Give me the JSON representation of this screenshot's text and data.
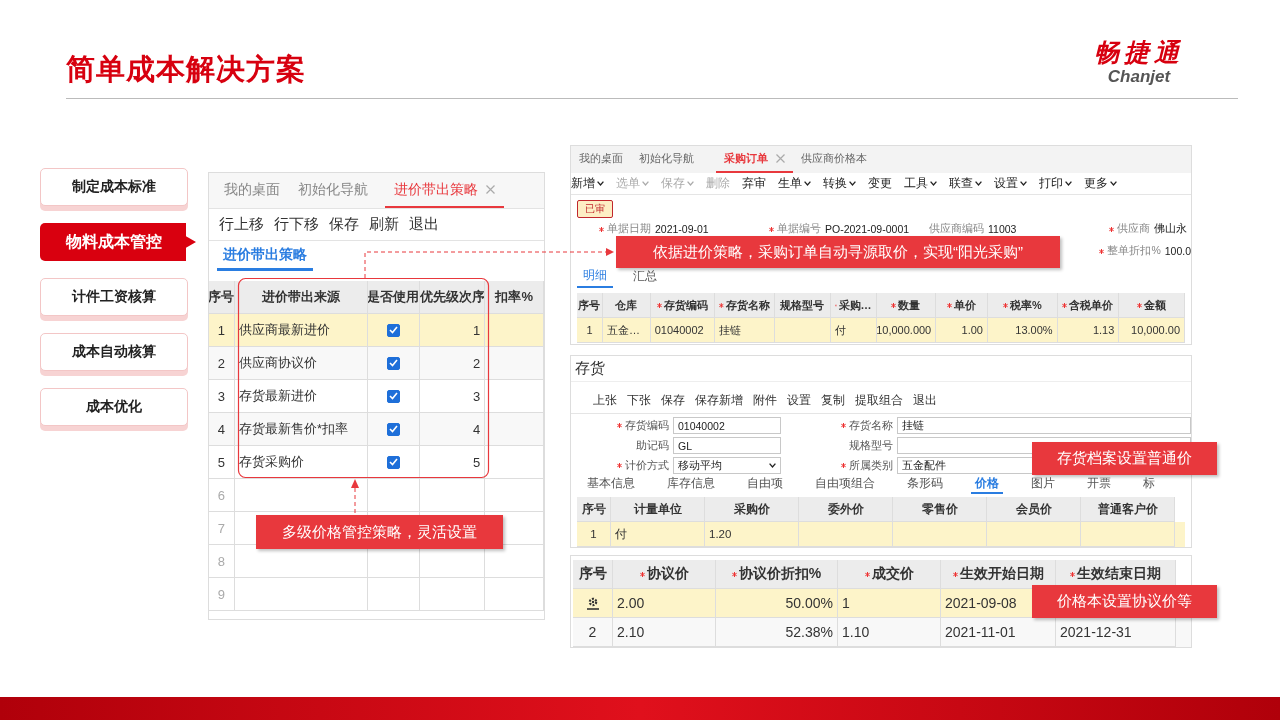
{
  "title": "简单成本解决方案",
  "logo": {
    "name": "畅捷通",
    "latin": "Chanjet"
  },
  "nav": [
    {
      "label": "制定成本标准",
      "selected": false
    },
    {
      "label": "物料成本管控",
      "selected": true
    },
    {
      "label": "计件工资核算",
      "selected": false
    },
    {
      "label": "成本自动核算",
      "selected": false
    },
    {
      "label": "成本优化",
      "selected": false
    }
  ],
  "strategy_window": {
    "tabs": [
      {
        "label": "我的桌面",
        "selected": false,
        "closable": false
      },
      {
        "label": "初始化导航",
        "selected": false,
        "closable": false
      },
      {
        "label": "进价带出策略",
        "selected": true,
        "closable": true
      }
    ],
    "toolbar": [
      "行上移",
      "行下移",
      "保存",
      "刷新",
      "退出"
    ],
    "subtabs": [
      {
        "label": "进价带出策略",
        "selected": true
      }
    ],
    "columns": [
      "序号",
      "进价带出来源",
      "是否使用",
      "优先级次序",
      "扣率%"
    ],
    "rows": [
      {
        "index": "1",
        "source": "供应商最新进价",
        "used": true,
        "priority": "1",
        "selected": true
      },
      {
        "index": "2",
        "source": "供应商协议价",
        "used": true,
        "priority": "2",
        "selected": false
      },
      {
        "index": "3",
        "source": "存货最新进价",
        "used": true,
        "priority": "3",
        "selected": false
      },
      {
        "index": "4",
        "source": "存货最新售价*扣率",
        "used": true,
        "priority": "4",
        "selected": false
      },
      {
        "index": "5",
        "source": "存货采购价",
        "used": true,
        "priority": "5",
        "selected": false
      }
    ],
    "empty_rows": [
      "6",
      "7",
      "8",
      "9"
    ]
  },
  "order_window": {
    "tabs": [
      {
        "label": "我的桌面",
        "selected": false,
        "closable": false
      },
      {
        "label": "初始化导航",
        "selected": false,
        "closable": false
      },
      {
        "label": "采购订单",
        "selected": true,
        "closable": true
      },
      {
        "label": "供应商价格本",
        "selected": false,
        "closable": false
      }
    ],
    "toolbar": [
      {
        "label": "新增",
        "menu": true,
        "disabled": false
      },
      {
        "label": "选单",
        "menu": true,
        "disabled": true
      },
      {
        "label": "保存",
        "menu": true,
        "disabled": true
      },
      {
        "label": "删除",
        "menu": false,
        "disabled": true
      },
      {
        "label": "弃审",
        "menu": false,
        "disabled": false
      },
      {
        "label": "生单",
        "menu": true,
        "disabled": false
      },
      {
        "label": "转换",
        "menu": true,
        "disabled": false
      },
      {
        "label": "变更",
        "menu": false,
        "disabled": false
      },
      {
        "label": "工具",
        "menu": true,
        "disabled": false
      },
      {
        "label": "联查",
        "menu": true,
        "disabled": false
      },
      {
        "label": "设置",
        "menu": true,
        "disabled": false
      },
      {
        "label": "打印",
        "menu": true,
        "disabled": false
      },
      {
        "label": "更多",
        "menu": true,
        "disabled": false
      }
    ],
    "status": "已审",
    "fields": [
      {
        "label": "单据日期",
        "value": "2021-09-01",
        "required": true
      },
      {
        "label": "单据编号",
        "value": "PO-2021-09-0001",
        "required": true
      },
      {
        "label": "供应商编码",
        "value": "11003",
        "required": false
      },
      {
        "label": "供应商",
        "value": "佛山永",
        "required": true
      }
    ],
    "fields_row_2": [
      {
        "label": "整单折扣%",
        "value": "100.0",
        "required": true
      }
    ],
    "subtabs": [
      {
        "label": "明细",
        "selected": true
      },
      {
        "label": "汇总",
        "selected": false
      }
    ],
    "columns": [
      {
        "label": "序号",
        "required": false
      },
      {
        "label": "仓库",
        "required": false
      },
      {
        "label": "存货编码",
        "required": true
      },
      {
        "label": "存货名称",
        "required": true
      },
      {
        "label": "规格型号",
        "required": false
      },
      {
        "label": "采购…",
        "required": true
      },
      {
        "label": "数量",
        "required": true
      },
      {
        "label": "单价",
        "required": true
      },
      {
        "label": "税率%",
        "required": true
      },
      {
        "label": "含税单价",
        "required": true
      },
      {
        "label": "金额",
        "required": true
      }
    ],
    "rows": [
      {
        "selected": true,
        "cells": [
          "1",
          "五金…",
          "01040002",
          "挂链",
          null,
          "付",
          "10,000.000",
          "1.00",
          "13.00%",
          "1.13",
          "10,000.00"
        ]
      }
    ]
  },
  "item_window": {
    "title": "存货",
    "toolbar": [
      "上张",
      "下张",
      "保存",
      "保存新增",
      "附件",
      "设置",
      "复制",
      "提取组合",
      "退出"
    ],
    "fields": [
      {
        "label": "存货编码",
        "value": "01040002",
        "required": true,
        "kind": "text"
      },
      {
        "label": "存货名称",
        "value": "挂链",
        "required": true,
        "kind": "text"
      },
      {
        "label": "助记码",
        "value": "GL",
        "required": false,
        "kind": "text"
      },
      {
        "label": "规格型号",
        "required": false,
        "kind": "text"
      },
      {
        "label": "计价方式",
        "value": "移动平均",
        "required": true,
        "kind": "select"
      },
      {
        "label": "所属类别",
        "value": "五金配件",
        "required": true,
        "kind": "text"
      }
    ],
    "tabs": [
      {
        "label": "基本信息",
        "selected": false
      },
      {
        "label": "库存信息",
        "selected": false
      },
      {
        "label": "自由项",
        "selected": false
      },
      {
        "label": "自由项组合",
        "selected": false
      },
      {
        "label": "条形码",
        "selected": false
      },
      {
        "label": "价格",
        "selected": true
      },
      {
        "label": "图片",
        "selected": false
      },
      {
        "label": "开票",
        "selected": false
      },
      {
        "label": "标",
        "selected": false
      }
    ],
    "columns": [
      "序号",
      "计量单位",
      "采购价",
      "委外价",
      "零售价",
      "会员价",
      "普通客户价"
    ],
    "rows": [
      {
        "selected": true,
        "cells": [
          "1",
          "付",
          "1.20",
          null,
          null,
          null,
          null
        ]
      }
    ]
  },
  "price_book": {
    "columns": [
      {
        "label": "序号",
        "required": false
      },
      {
        "label": "协议价",
        "required": true
      },
      {
        "label": "协议价折扣%",
        "required": true
      },
      {
        "label": "成交价",
        "required": true
      },
      {
        "label": "生效开始日期",
        "required": true
      },
      {
        "label": "生效结束日期",
        "required": true
      }
    ],
    "rows": [
      {
        "selected": true,
        "cells": [
          null,
          "2.00",
          "50.00%",
          "1",
          "2021-09-08",
          null
        ]
      },
      {
        "selected": false,
        "cells": [
          "2",
          "2.10",
          "52.38%",
          "1.10",
          "2021-11-01",
          "2021-12-31"
        ]
      }
    ]
  },
  "callouts": [
    "依据进价策略，采购订单自动寻源取价，实现“阳光采购”",
    "多级价格管控策略，灵活设置",
    "存货档案设置普通价",
    "价格本设置协议价等"
  ]
}
